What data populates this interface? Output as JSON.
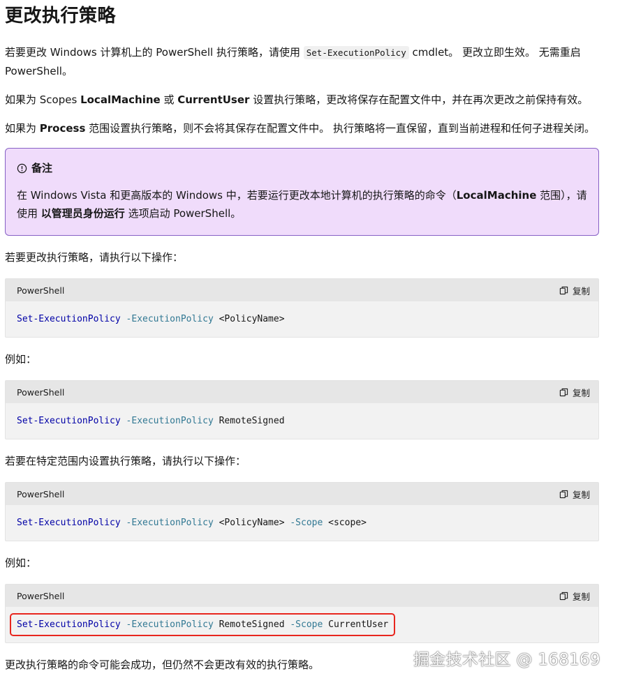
{
  "title": "更改执行策略",
  "paragraph1": {
    "before": "若要更改 Windows 计算机上的 PowerShell 执行策略，请使用 ",
    "code": "Set-ExecutionPolicy",
    "after": " cmdlet。 更改立即生效。 无需重启 PowerShell。"
  },
  "paragraph2": {
    "before": "如果为 Scopes ",
    "bold1": "LocalMachine",
    "middle": " 或 ",
    "bold2": "CurrentUser",
    "after": " 设置执行策略，更改将保存在配置文件中，并在再次更改之前保持有效。"
  },
  "paragraph3": {
    "before": "如果为 ",
    "bold": "Process",
    "after": " 范围设置执行策略，则不会将其保存在配置文件中。 执行策略将一直保留，直到当前进程和任何子进程关闭。"
  },
  "note": {
    "icon": "info-circle-icon",
    "title": "备注",
    "body_before": "在 Windows Vista 和更高版本的 Windows 中，若要运行更改本地计算机的执行策略的命令（",
    "body_bold1": "LocalMachine",
    "body_mid": " 范围），请使用 ",
    "body_bold2": "以管理员身份运行",
    "body_after": " 选项启动 PowerShell。"
  },
  "blocks": [
    {
      "intro": "若要更改执行策略，请执行以下操作：",
      "language": "PowerShell",
      "copy_label": "复制",
      "cmd": "Set-ExecutionPolicy",
      "param1": "-ExecutionPolicy",
      "arg1": "<PolicyName>",
      "param2": "",
      "arg2": ""
    },
    {
      "intro": "例如：",
      "language": "PowerShell",
      "copy_label": "复制",
      "cmd": "Set-ExecutionPolicy",
      "param1": "-ExecutionPolicy",
      "arg1": "RemoteSigned",
      "param2": "",
      "arg2": ""
    },
    {
      "intro": "若要在特定范围内设置执行策略，请执行以下操作：",
      "language": "PowerShell",
      "copy_label": "复制",
      "cmd": "Set-ExecutionPolicy",
      "param1": "-ExecutionPolicy",
      "arg1": "<PolicyName>",
      "param2": "-Scope",
      "arg2": "<scope>"
    },
    {
      "intro": "例如：",
      "language": "PowerShell",
      "copy_label": "复制",
      "cmd": "Set-ExecutionPolicy",
      "param1": "-ExecutionPolicy",
      "arg1": "RemoteSigned",
      "param2": "-Scope",
      "arg2": "CurrentUser"
    }
  ],
  "closing": "更改执行策略的命令可能会成功，但仍然不会更改有效的执行策略。",
  "watermark": "掘金技术社区 @ 168169",
  "colors": {
    "note_bg": "#f0dcfb",
    "note_border": "#8661c5",
    "cmd": "#0000a6",
    "param": "#317893",
    "highlight": "#e8261e"
  }
}
